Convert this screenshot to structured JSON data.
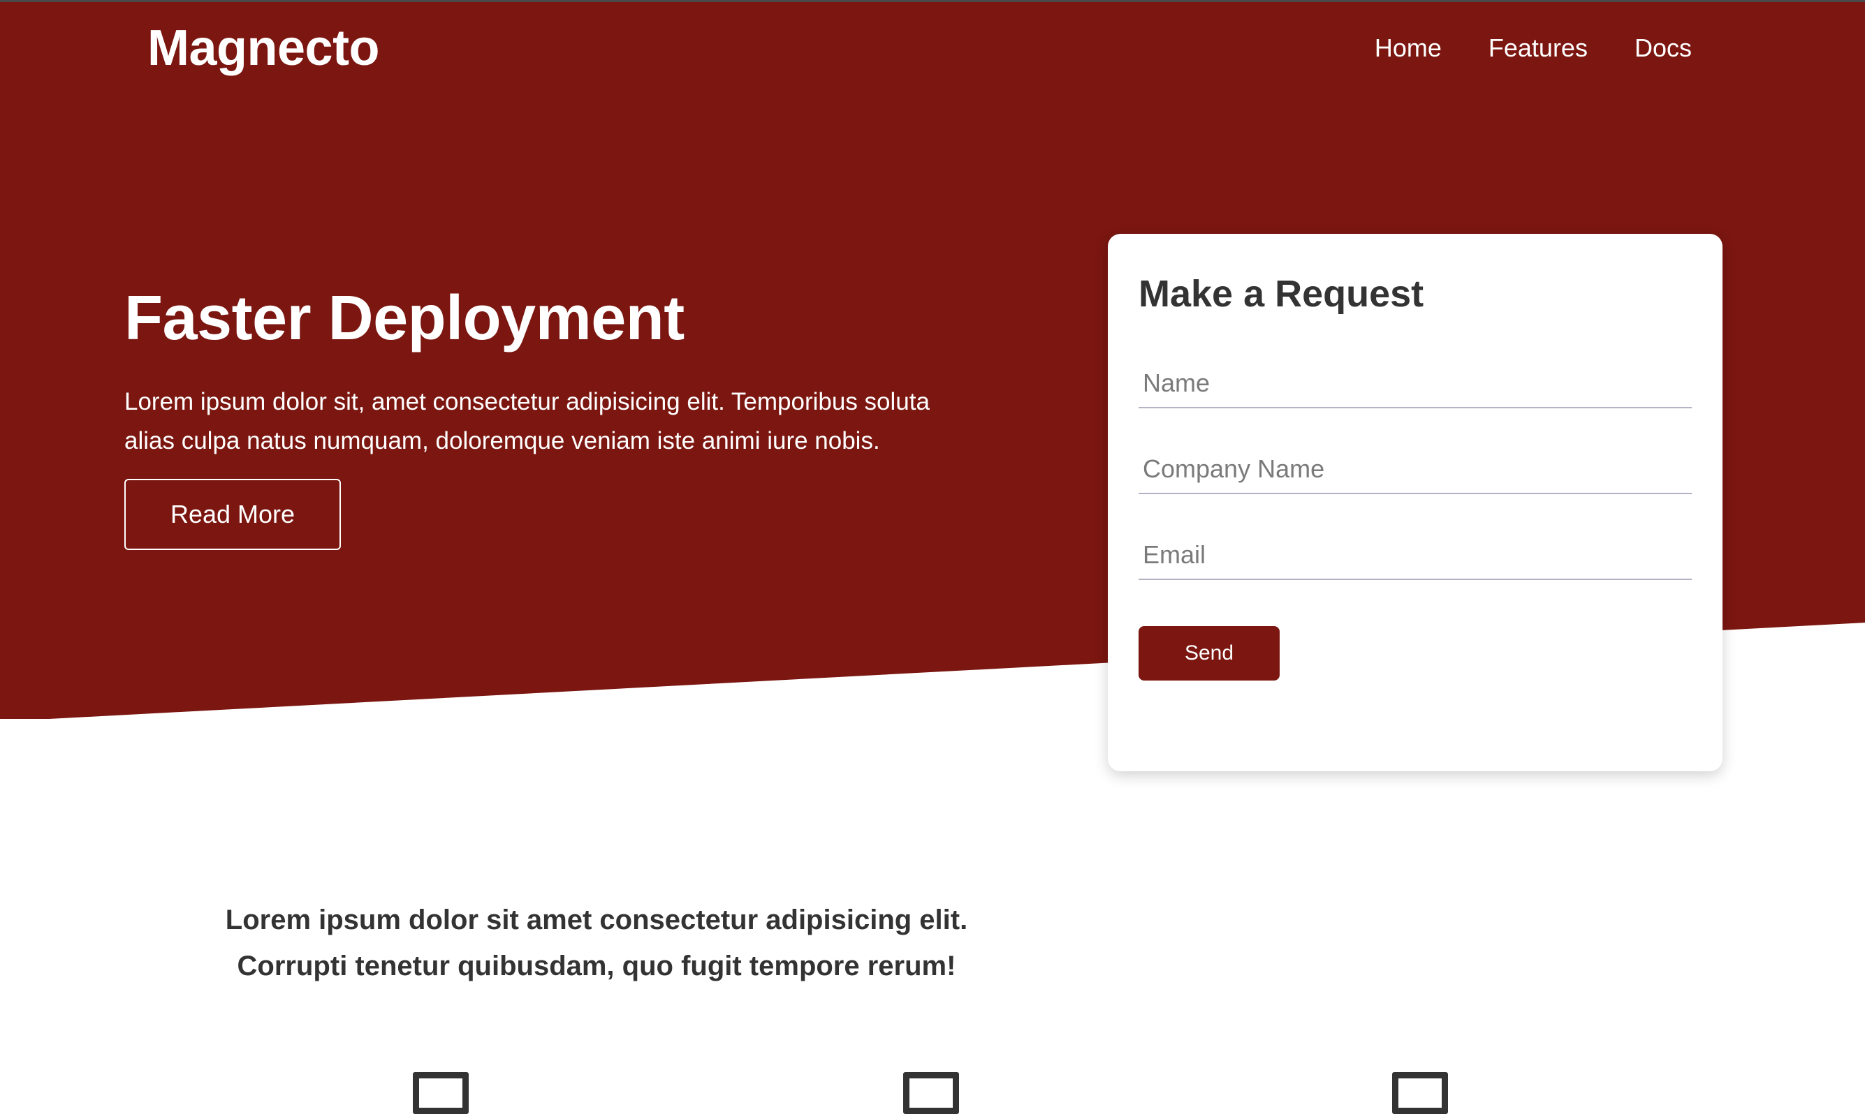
{
  "header": {
    "brand": "Magnecto",
    "nav": [
      "Home",
      "Features",
      "Docs"
    ]
  },
  "hero": {
    "title": "Faster Deployment",
    "text": "Lorem ipsum dolor sit, amet consectetur adipisicing elit. Temporibus soluta alias culpa natus numquam, doloremque veniam iste animi iure nobis.",
    "read_more_label": "Read More"
  },
  "request_form": {
    "title": "Make a Request",
    "name_placeholder": "Name",
    "company_placeholder": "Company Name",
    "email_placeholder": "Email",
    "send_label": "Send"
  },
  "section": {
    "tagline_line1": "Lorem ipsum dolor sit amet consectetur adipisicing elit.",
    "tagline_line2": "Corrupti tenetur quibusdam, quo fugit tempore rerum!"
  },
  "features": {
    "icons": [
      "square-icon",
      "square-icon",
      "square-icon"
    ]
  },
  "colors": {
    "brand": "#7b1610",
    "text_dark": "#333333",
    "white": "#ffffff"
  }
}
